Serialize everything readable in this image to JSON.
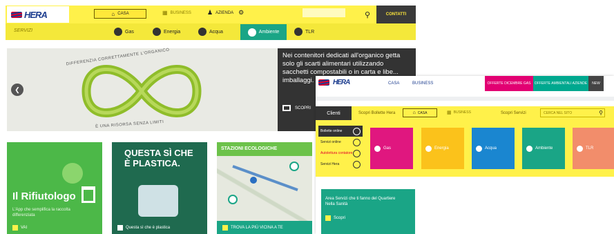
{
  "left": {
    "logo": "HERA",
    "nav": {
      "home": "CASA",
      "business": "BUSINESS",
      "company": "AZIENDA",
      "contacts": "CONTATTI"
    },
    "services_label": "SERVIZI",
    "tabs": [
      {
        "label": "Gas",
        "icon": "flame-icon"
      },
      {
        "label": "Energia",
        "icon": "lightning-icon"
      },
      {
        "label": "Acqua",
        "icon": "water-drop-icon"
      },
      {
        "label": "Ambiente",
        "icon": "leaf-icon"
      },
      {
        "label": "TLR",
        "icon": "heating-icon"
      }
    ],
    "hero": {
      "arc_top": "DIFFERENZIA CORRETTAMENTE L'ORGANICO",
      "arc_bottom": "È UNA RISORSA SENZA LIMITI",
      "text": "Nei contenitori dedicati all'organico getta solo gli scarti alimentari utilizzando sacchetti compostabili o in carta e libe... imballaggi.",
      "cta": "SCOPRI"
    },
    "cards": [
      {
        "title": "Il Rifiutologo",
        "subtitle": "L'App che semplifica la raccolta differenziata",
        "cta": "VAI",
        "bg": "#4cb848"
      },
      {
        "title": "QUESTA SÌ CHE È PLASTICA.",
        "cta": "Questa sì che è plastica",
        "bg": "#1f6a4f"
      },
      {
        "title": "STAZIONI ECOLOGICHE",
        "cta": "TROVA LA PIÙ VICINA A TE",
        "bg": "#6cc24a"
      }
    ]
  },
  "right": {
    "logo": "HERA",
    "top_links": [
      "CASA",
      "BUSINESS"
    ],
    "colored_tabs": [
      {
        "label": "OFFERTE DICEMBRE GAS",
        "color": "#e20072"
      },
      {
        "label": "OFFERTE AMBIENTALI AZIENDE",
        "color": "#00a88f"
      },
      {
        "label": "NEW",
        "color": "#444444"
      }
    ],
    "clients_label": "Clienti",
    "sub_left": "Scopri Bollette Hera",
    "sub_home": "CASA",
    "sub_business": "BUSINESS",
    "sub_right": "Scopri Servizi",
    "search_placeholder": "CERCA NEL SITO",
    "side_links": [
      "Bollette online",
      "Servizi online",
      "Autolettura contatore",
      "Servizi Hera"
    ],
    "tiles": [
      {
        "label": "Gas",
        "color": "#e0177f"
      },
      {
        "label": "Energia",
        "color": "#fbc21b"
      },
      {
        "label": "Acqua",
        "color": "#1a86d0"
      },
      {
        "label": "Ambiente",
        "color": "#1aa586"
      },
      {
        "label": "TLR",
        "color": "#f28d6b"
      }
    ],
    "green_box": {
      "text": "Area Servizi che ti fanno del Quartiere Nella Sanità",
      "cta": "Scopri"
    }
  }
}
